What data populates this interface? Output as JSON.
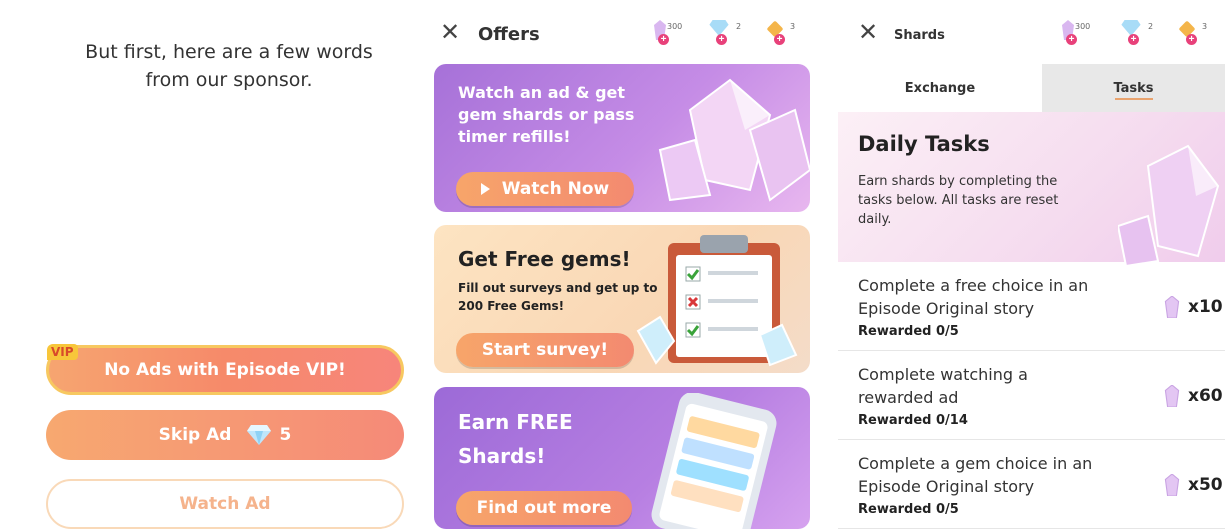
{
  "sponsor_screen": {
    "message": "But first, here are a few words\nfrom our sponsor.",
    "vip_badge": "VIP",
    "vip_button": "No Ads with Episode VIP!",
    "skip_ad_label": "Skip Ad",
    "skip_ad_cost": "5",
    "watch_ad_label": "Watch Ad"
  },
  "offers_screen": {
    "title": "Offers",
    "currencies": [
      {
        "amount": "300"
      },
      {
        "amount": "2"
      },
      {
        "amount": "3"
      }
    ],
    "cards": [
      {
        "title": "Watch an ad & get gem shards or pass timer refills!",
        "button": "Watch Now"
      },
      {
        "title": "Get Free gems!",
        "subtitle": "Fill out surveys and get up to 200 Free Gems!",
        "button": "Start survey!"
      },
      {
        "title": "Earn FREE Shards!",
        "button": "Find out more"
      }
    ]
  },
  "shards_screen": {
    "title": "Shards",
    "currencies": [
      {
        "amount": "300"
      },
      {
        "amount": "2"
      },
      {
        "amount": "3"
      }
    ],
    "tabs": [
      {
        "label": "Exchange"
      },
      {
        "label": "Tasks"
      }
    ],
    "daily": {
      "title": "Daily Tasks",
      "description": "Earn shards by completing the tasks below. All tasks are reset daily."
    },
    "tasks": [
      {
        "text": "Complete a free choice in an Episode Original story",
        "progress": "Rewarded 0/5",
        "reward": "x10"
      },
      {
        "text": "Complete watching a rewarded ad",
        "progress": "Rewarded 0/14",
        "reward": "x60"
      },
      {
        "text": "Complete a gem choice in an Episode Original story",
        "progress": "Rewarded 0/5",
        "reward": "x50"
      }
    ]
  },
  "colors": {
    "accent_orange": "#f38a70",
    "purple": "#a671d8",
    "gem_pink": "#e8417a"
  }
}
